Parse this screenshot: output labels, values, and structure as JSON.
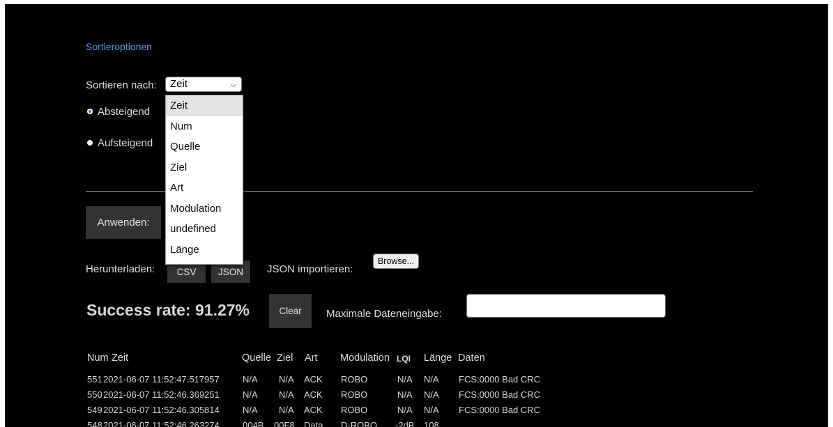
{
  "sort": {
    "heading": "Sortieroptionen",
    "sort_by_label": "Sortieren nach:",
    "selected": "Zeit",
    "options": [
      "Zeit",
      "Num",
      "Quelle",
      "Ziel",
      "Art",
      "Modulation",
      "undefined",
      "Länge"
    ],
    "descending_label": "Absteigend",
    "ascending_label": "Aufsteigend",
    "descending_checked": true
  },
  "actions": {
    "apply_label": "Anwenden:",
    "download_label": "Herunterladen:",
    "csv_label": "CSV",
    "json_label": "JSON",
    "import_label": "JSON importieren:",
    "browse_label": "Browse..."
  },
  "stats": {
    "success_rate": "Success rate: 91.27%",
    "clear_label": "Clear",
    "max_input_label": "Maximale Dateneingabe:",
    "max_input_value": ""
  },
  "table": {
    "headers": [
      "Num",
      "Zeit",
      "Quelle",
      "Ziel",
      "Art",
      "Modulation",
      "LQI",
      "Länge",
      "Daten"
    ],
    "rows": [
      [
        "551",
        "2021-06-07 11:52:47.517957",
        "N/A",
        "N/A",
        "ACK",
        "ROBO",
        "N/A",
        "N/A",
        "FCS:0000 Bad CRC"
      ],
      [
        "550",
        "2021-06-07 11:52:46.369251",
        "N/A",
        "N/A",
        "ACK",
        "ROBO",
        "N/A",
        "N/A",
        "FCS:0000 Bad CRC"
      ],
      [
        "549",
        "2021-06-07 11:52:46.305814",
        "N/A",
        "N/A",
        "ACK",
        "ROBO",
        "N/A",
        "N/A",
        "FCS:0000 Bad CRC"
      ],
      [
        "548",
        "2021-06-07 11:52:46.263274",
        "004B",
        "00F8",
        "Data",
        "D-ROBO",
        "-2dB",
        "108",
        ""
      ]
    ]
  }
}
